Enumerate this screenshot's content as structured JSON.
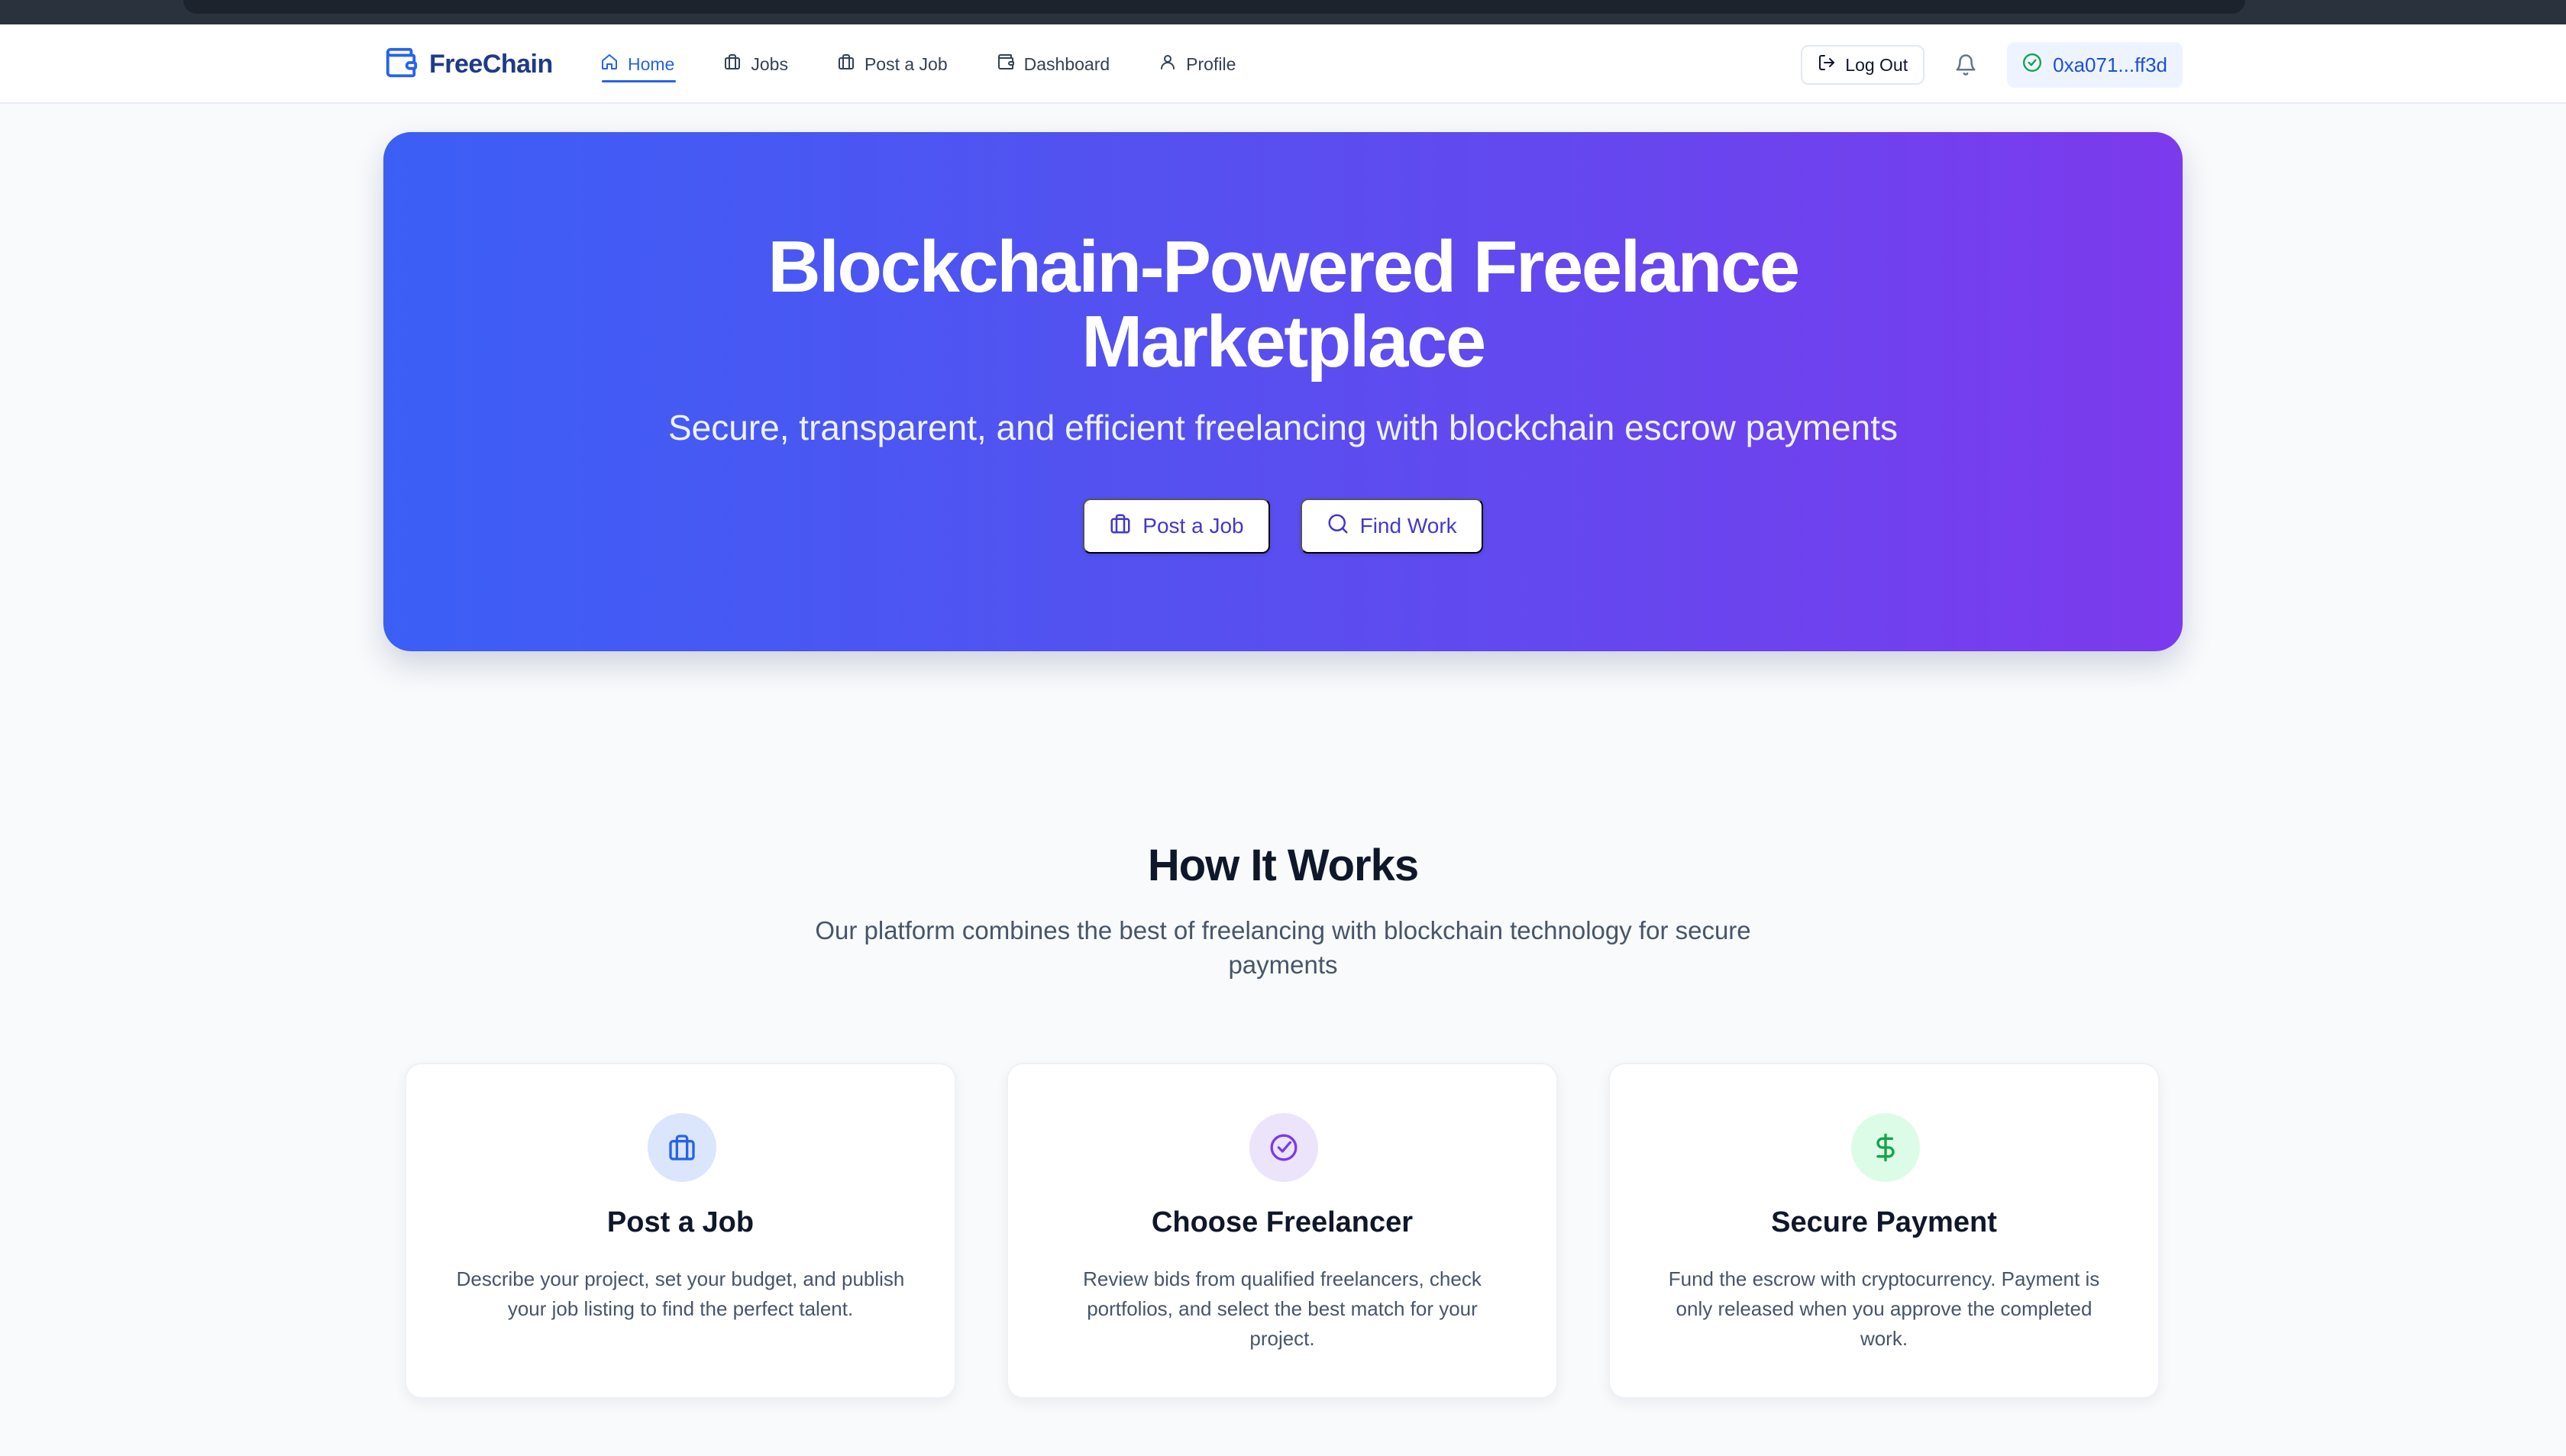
{
  "nav": {
    "brand": "FreeChain",
    "links": [
      {
        "label": "Home",
        "icon": "home-icon",
        "active": true
      },
      {
        "label": "Jobs",
        "icon": "briefcase-icon",
        "active": false
      },
      {
        "label": "Post a Job",
        "icon": "briefcase-icon",
        "active": false
      },
      {
        "label": "Dashboard",
        "icon": "wallet-icon",
        "active": false
      },
      {
        "label": "Profile",
        "icon": "user-icon",
        "active": false
      }
    ],
    "logout_label": "Log Out",
    "wallet_address": "0xa071...ff3d"
  },
  "hero": {
    "title_line1": "Blockchain-Powered Freelance",
    "title_line2": "Marketplace",
    "subtitle": "Secure, transparent, and efficient freelancing with blockchain escrow payments",
    "post_job_label": "Post a Job",
    "find_work_label": "Find Work"
  },
  "how": {
    "title": "How It Works",
    "subtitle": "Our platform combines the best of freelancing with blockchain technology for secure payments",
    "cards": [
      {
        "title": "Post a Job",
        "description": "Describe your project, set your budget, and publish your job listing to find the perfect talent.",
        "icon": "briefcase-icon",
        "icon_color": "#2563eb",
        "icon_bg": "#dbe5fb"
      },
      {
        "title": "Choose Freelancer",
        "description": "Review bids from qualified freelancers, check portfolios, and select the best match for your project.",
        "icon": "check-circle-icon",
        "icon_color": "#7c3aed",
        "icon_bg": "#ece4fb"
      },
      {
        "title": "Secure Payment",
        "description": "Fund the escrow with cryptocurrency. Payment is only released when you approve the completed work.",
        "icon": "dollar-icon",
        "icon_color": "#16a34a",
        "icon_bg": "#dcfce7"
      }
    ]
  },
  "colors": {
    "brand": "#1e3a8a",
    "accent": "#2563eb",
    "hero_gradient_start": "#3b5ff5",
    "hero_gradient_end": "#7c3aed"
  }
}
